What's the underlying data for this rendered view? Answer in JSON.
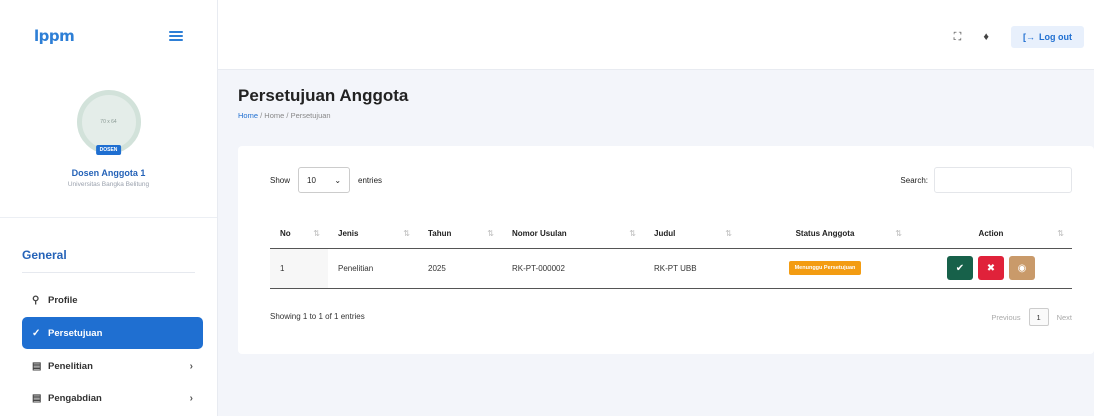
{
  "app": {
    "logo": "lppm"
  },
  "profile": {
    "avatar_text": "70 x 64",
    "badge": "DOSEN",
    "name": "Dosen Anggota 1",
    "university": "Universitas Bangka Belitung"
  },
  "sidebar": {
    "section_title": "General",
    "items": [
      {
        "label": "Profile",
        "icon": "person-icon"
      },
      {
        "label": "Persetujuan",
        "icon": "check-icon",
        "active": true
      },
      {
        "label": "Penelitian",
        "icon": "document-icon",
        "has_children": true
      },
      {
        "label": "Pengabdian",
        "icon": "document-icon",
        "has_children": true
      }
    ]
  },
  "topbar": {
    "logout_label": "Log out"
  },
  "page": {
    "title": "Persetujuan Anggota",
    "breadcrumb": [
      "Home",
      "Home",
      "Persetujuan"
    ]
  },
  "table_controls": {
    "show_label": "Show",
    "entries_value": "10",
    "entries_label": "entries",
    "search_label": "Search:",
    "search_value": ""
  },
  "table": {
    "columns": [
      "No",
      "Jenis",
      "Tahun",
      "Nomor Usulan",
      "Judul",
      "Status Anggota",
      "Action"
    ],
    "rows": [
      {
        "no": "1",
        "jenis": "Penelitian",
        "tahun": "2025",
        "nomor_usulan": "RK-PT-000002",
        "judul": "RK-PT UBB",
        "status": "Menunggu Persetujuan"
      }
    ]
  },
  "footer": {
    "showing_text": "Showing 1 to 1 of 1 entries",
    "prev_label": "Previous",
    "page": "1",
    "next_label": "Next"
  },
  "colors": {
    "primary": "#1f6fd1",
    "status_pending": "#f39c12",
    "approve": "#17614a",
    "reject": "#e0223a",
    "view": "#c99a6a"
  }
}
